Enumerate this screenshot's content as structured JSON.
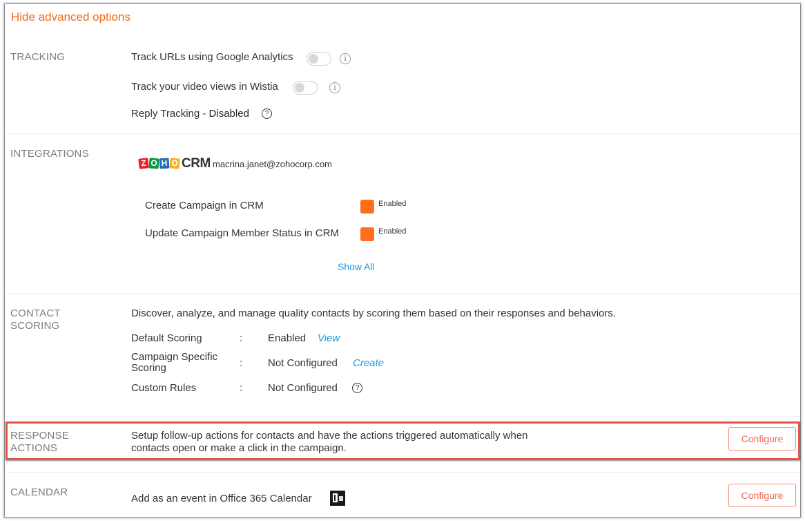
{
  "header": {
    "hide_advanced_label": "Hide advanced options"
  },
  "tracking": {
    "label": "TRACKING",
    "google_analytics": {
      "label": "Track URLs using Google Analytics",
      "enabled": false
    },
    "wistia": {
      "label": "Track your video views in Wistia",
      "enabled": false
    },
    "reply_tracking": {
      "prefix": "Reply Tracking - ",
      "status": "Disabled"
    },
    "info_glyph": "i",
    "help_glyph": "?"
  },
  "integrations": {
    "label": "INTEGRATIONS",
    "logo_letters": [
      "Z",
      "O",
      "H",
      "O"
    ],
    "crm_word": "CRM",
    "account_email": "macrina.janet@zohocorp.com",
    "items": [
      {
        "label": "Create Campaign in CRM",
        "status": "Enabled",
        "status_color": "#ff6e1a"
      },
      {
        "label": "Update Campaign Member Status in CRM",
        "status": "Enabled",
        "status_color": "#ff6e1a"
      }
    ],
    "show_all_label": "Show All"
  },
  "contact_scoring": {
    "label_line1": "CONTACT",
    "label_line2": "SCORING",
    "description": "Discover, analyze, and manage quality contacts by scoring them based on their responses and behaviors.",
    "separator": ":",
    "rows": [
      {
        "label": "Default Scoring",
        "value": "Enabled",
        "action": "View"
      },
      {
        "label_line1": "Campaign Specific",
        "label_line2": "Scoring",
        "value": "Not Configured",
        "action": "Create"
      },
      {
        "label": "Custom Rules",
        "value": "Not Configured",
        "help_glyph": "?"
      }
    ]
  },
  "response_actions": {
    "label_line1": "RESPONSE",
    "label_line2": "ACTIONS",
    "description_line1": "Setup follow-up actions for contacts and have the actions triggered automatically when",
    "description_line2": "contacts open or make a click in the campaign.",
    "button_label": "Configure",
    "highlight_color": "#e8544a"
  },
  "calendar": {
    "label": "CALENDAR",
    "description": "Add as an event in Office 365 Calendar",
    "icon": "office-365-icon",
    "button_label": "Configure"
  },
  "colors": {
    "accent_orange": "#f26a1b",
    "link_blue": "#1e96e6",
    "button_border": "#f48b73"
  }
}
